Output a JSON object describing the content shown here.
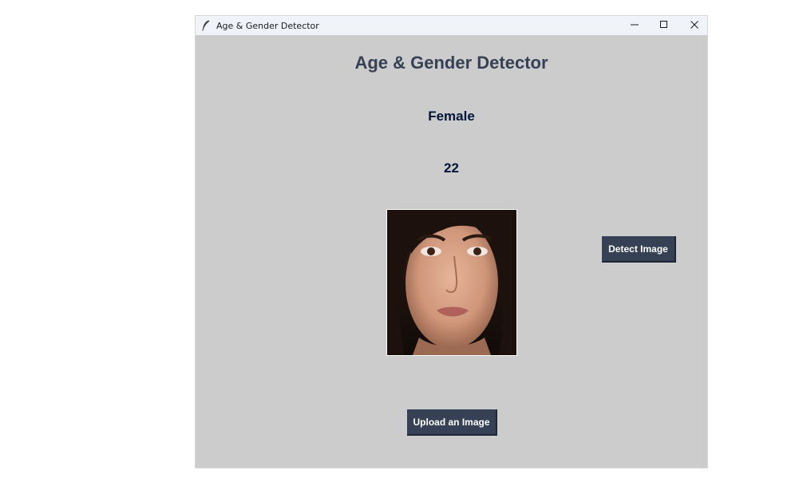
{
  "window": {
    "title": "Age & Gender Detector",
    "icon": "feather-icon",
    "controls": [
      "minimize-icon",
      "maximize-icon",
      "close-icon"
    ]
  },
  "main": {
    "heading": "Age & Gender Detector",
    "gender_result": "Female",
    "age_result": "22",
    "image": "portrait-photo-of-woman"
  },
  "buttons": {
    "detect_label": "Detect Image",
    "upload_label": "Upload an Image"
  },
  "colors": {
    "background": "#cccccc",
    "heading": "#364156",
    "result_text": "#011638",
    "button_bg": "#364156",
    "button_text": "#ffffff"
  }
}
